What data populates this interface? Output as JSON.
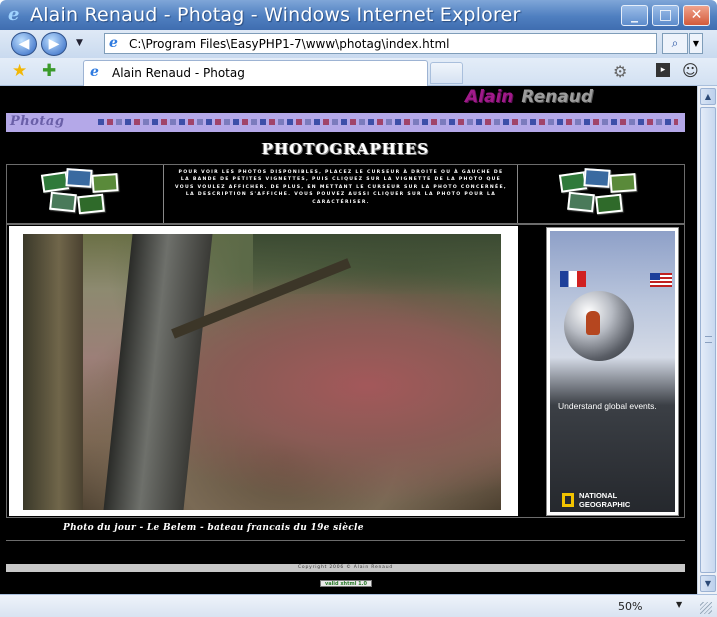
{
  "window": {
    "title": "Alain Renaud - Photag - Windows Internet Explorer",
    "buttons": {
      "minimize": "_",
      "maximize": "□",
      "close": "✕"
    }
  },
  "address_bar": {
    "url": "C:\\Program Files\\EasyPHP1-7\\www\\photag\\index.html",
    "back_glyph": "◀",
    "forward_glyph": "▶",
    "dropdown_glyph": "▼",
    "search_glyph": "⌕"
  },
  "tabs": [
    {
      "label": "Alain Renaud - Photag",
      "active": true
    }
  ],
  "toolbar_icons": [
    "favorites-star-icon",
    "add-favorites-icon",
    "home-icon",
    "page-icon",
    "tools-icon"
  ],
  "page": {
    "brand": {
      "first": "Alain",
      "last": "Renaud"
    },
    "logo": "Photag",
    "heading": "PHOTOGRAPHIES",
    "instructions": "Pour voir les photos disponibles, placez le curseur à droite ou à gauche de la bande de petites vignettes, puis cliquez sur la vignette de la photo que vous voulez afficher. De plus, en mettant le curseur sur la photo concernée, la description s'affiche. Vous pouvez aussi cliquer sur la photo pour la caractériser.",
    "caption": "Photo du jour - Le Belem - bateau francais du 19e siècle",
    "ad": {
      "headline": "Understand global events.",
      "brand_line1": "NATIONAL",
      "brand_line2": "GEOGRAPHIC"
    },
    "copyright": "Copyright 2006 © Alain Renaud",
    "badge": "valid xhtml 1.0"
  },
  "status_bar": {
    "zoom": "50%",
    "zoom_dropdown_glyph": "▼"
  },
  "colors": {
    "brand_first": "#a11a8a",
    "stripe": "#b4a8e8",
    "page_background": "#000000"
  }
}
